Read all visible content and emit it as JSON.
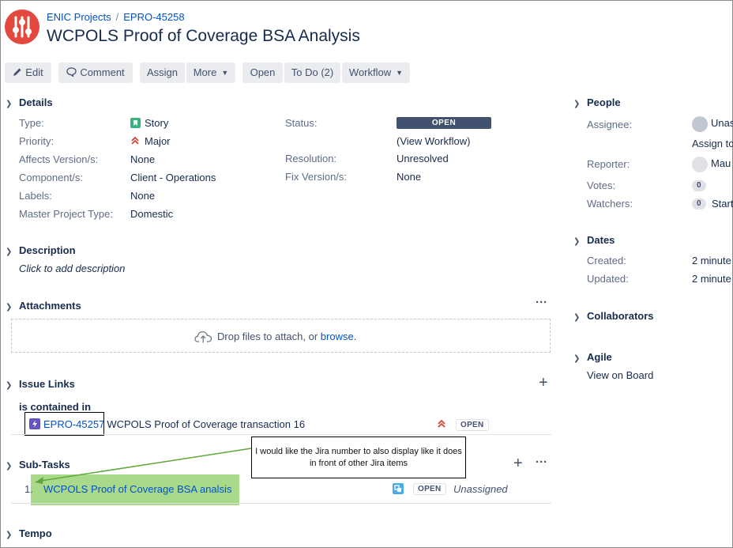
{
  "breadcrumb": {
    "project": "ENIC Projects",
    "separator": "/",
    "issue_key": "EPRO-45258"
  },
  "issue": {
    "title": "WCPOLS Proof of Coverage BSA Analysis"
  },
  "toolbar": {
    "edit": "Edit",
    "comment": "Comment",
    "assign": "Assign",
    "more": "More",
    "open": "Open",
    "todo": "To Do (2)",
    "workflow": "Workflow"
  },
  "details": {
    "heading": "Details",
    "type_label": "Type:",
    "type_value": "Story",
    "priority_label": "Priority:",
    "priority_value": "Major",
    "affects_label": "Affects Version/s:",
    "affects_value": "None",
    "component_label": "Component/s:",
    "component_value": "Client - Operations",
    "labels_label": "Labels:",
    "labels_value": "None",
    "master_label": "Master Project Type:",
    "master_value": "Domestic",
    "status_label": "Status:",
    "status_value": "OPEN",
    "view_workflow": "(View Workflow)",
    "resolution_label": "Resolution:",
    "resolution_value": "Unresolved",
    "fix_label": "Fix Version/s:",
    "fix_value": "None"
  },
  "description": {
    "heading": "Description",
    "placeholder": "Click to add description"
  },
  "attachments": {
    "heading": "Attachments",
    "more": "···",
    "drop_text": "Drop files to attach, or ",
    "browse": "browse."
  },
  "issue_links": {
    "heading": "Issue Links",
    "add": "+",
    "relation": "is contained in",
    "link_key": "EPRO-45257",
    "link_summary": "WCPOLS Proof of Coverage transaction 16",
    "link_status": "OPEN"
  },
  "subtasks": {
    "heading": "Sub-Tasks",
    "add": "+",
    "more": "···",
    "index": "1.",
    "summary": "WCPOLS Proof of Coverage BSA analsis",
    "status": "OPEN",
    "assignee": "Unassigned"
  },
  "tempo": {
    "heading": "Tempo"
  },
  "people": {
    "heading": "People",
    "assignee_label": "Assignee:",
    "assignee_value": "Unas",
    "assign_to_me": "Assign to",
    "reporter_label": "Reporter:",
    "reporter_value": "Mau",
    "votes_label": "Votes:",
    "votes_value": "0",
    "watchers_label": "Watchers:",
    "watchers_value": "0",
    "watch_action": "Start"
  },
  "dates": {
    "heading": "Dates",
    "created_label": "Created:",
    "created_value": "2 minute",
    "updated_label": "Updated:",
    "updated_value": "2 minute"
  },
  "collaborators": {
    "heading": "Collaborators"
  },
  "agile": {
    "heading": "Agile",
    "view_on_board": "View on Board"
  },
  "annotation": {
    "text": "I would like the Jira number to also display like it does in front of other Jira items"
  },
  "colors": {
    "accent": "#0052cc",
    "status_open_bg": "#42526e",
    "priority_major": "#d04437",
    "highlight": "#a9d98a",
    "arrow": "#5fa83c"
  }
}
